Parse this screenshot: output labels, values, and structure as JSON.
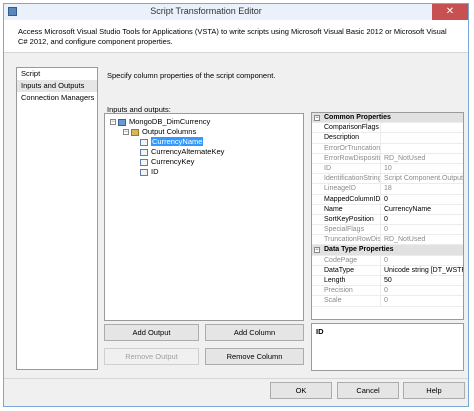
{
  "window": {
    "title": "Script Transformation Editor",
    "close_glyph": "✕"
  },
  "header": {
    "text": "Access Microsoft Visual Studio Tools for Applications (VSTA) to write scripts using Microsoft Visual Basic 2012 or Microsoft Visual C# 2012, and configure component properties."
  },
  "nav": {
    "items": [
      "Script",
      "Inputs and Outputs",
      "Connection Managers"
    ],
    "selected": "Inputs and Outputs"
  },
  "main": {
    "instruction": "Specify column properties of the script component.",
    "io_label": "Inputs and outputs:"
  },
  "tree": {
    "root": "MongoDB_DimCurrency",
    "folder": "Output Columns",
    "columns": [
      "CurrencyName",
      "CurrencyAlternateKey",
      "CurrencyKey",
      "ID"
    ],
    "selected": "CurrencyName"
  },
  "buttons": {
    "add_output": "Add Output",
    "add_column": "Add Column",
    "remove_output": "Remove Output",
    "remove_column": "Remove Column",
    "ok": "OK",
    "cancel": "Cancel",
    "help": "Help"
  },
  "properties": {
    "common": {
      "title": "Common Properties",
      "rows": [
        {
          "name": "ComparisonFlags",
          "value": "",
          "readonly": false
        },
        {
          "name": "Description",
          "value": "",
          "readonly": false
        },
        {
          "name": "ErrorOrTruncation",
          "value": "",
          "readonly": true
        },
        {
          "name": "ErrorRowDispositic",
          "value": "RD_NotUsed",
          "readonly": true
        },
        {
          "name": "ID",
          "value": "10",
          "readonly": true
        },
        {
          "name": "IdentificationString",
          "value": "Script Component.Output",
          "readonly": true
        },
        {
          "name": "LineageID",
          "value": "18",
          "readonly": true
        },
        {
          "name": "MappedColumnID",
          "value": "0",
          "readonly": false
        },
        {
          "name": "Name",
          "value": "CurrencyName",
          "readonly": false
        },
        {
          "name": "SortKeyPosition",
          "value": "0",
          "readonly": false
        },
        {
          "name": "SpecialFlags",
          "value": "0",
          "readonly": true
        },
        {
          "name": "TruncationRowDis",
          "value": "RD_NotUsed",
          "readonly": true
        }
      ]
    },
    "datatype": {
      "title": "Data Type Properties",
      "rows": [
        {
          "name": "CodePage",
          "value": "0",
          "readonly": true
        },
        {
          "name": "DataType",
          "value": "Unicode string [DT_WSTR]",
          "readonly": false
        },
        {
          "name": "Length",
          "value": "50",
          "readonly": false
        },
        {
          "name": "Precision",
          "value": "0",
          "readonly": true
        },
        {
          "name": "Scale",
          "value": "0",
          "readonly": true
        }
      ]
    }
  },
  "description": {
    "title": "ID"
  }
}
